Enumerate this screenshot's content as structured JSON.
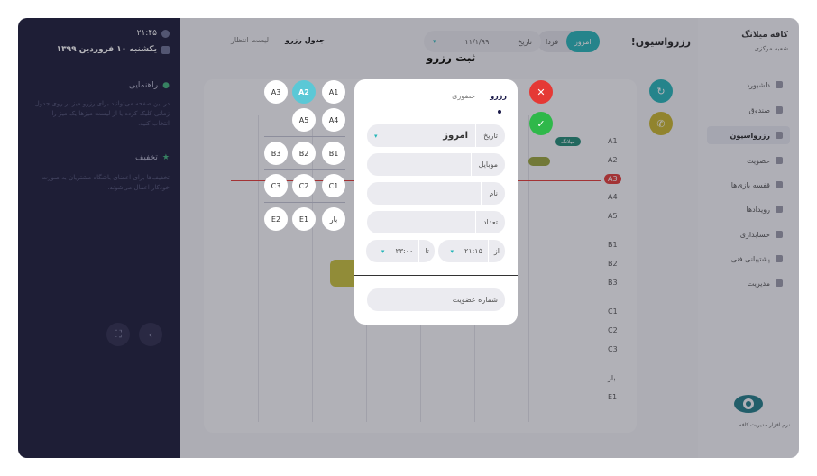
{
  "clock": {
    "time": "۲۱:۴۵",
    "date": "یکشنبه ۱۰ فروردین ۱۳۹۹"
  },
  "guide": {
    "title": "راهنمایی",
    "text": "در این صفحه می‌توانید برای رزرو میز بر روی جدول زمانی کلیک کرده یا از لیست میزها یک میز را انتخاب کنید."
  },
  "discount": {
    "title": "تخفیف",
    "text": "تخفیف‌ها برای اعضای باشگاه مشتریان به صورت خودکار اعمال می‌شوند."
  },
  "sidebar": {
    "brand": "کافه میلانگ",
    "branch": "شعبه مرکزی",
    "items": [
      {
        "label": "داشبورد"
      },
      {
        "label": "صندوق"
      },
      {
        "label": "رزرواسیون"
      },
      {
        "label": "عضویت"
      },
      {
        "label": "قفسه بازی‌ها"
      },
      {
        "label": "رویدادها"
      },
      {
        "label": "حسابداری"
      },
      {
        "label": "پشتیبانی فنی"
      },
      {
        "label": "مدیریت"
      }
    ],
    "footer": "نرم افزار مدیریت کافه"
  },
  "header": {
    "title": "رزرواسیون!",
    "day_today": "امروز",
    "day_tomorrow": "فردا",
    "date_label": "تاریخ",
    "date_value": "۱۱/۱/۹۹",
    "tab_schedule": "جدول رزرو",
    "tab_waitlist": "لیست انتظار"
  },
  "grid": {
    "rows": [
      "A1",
      "A2",
      "A3",
      "A4",
      "A5",
      "B1",
      "B2",
      "B3",
      "C1",
      "C2",
      "C3",
      "بار",
      "E1"
    ],
    "booking_label": "میلانگ"
  },
  "modal": {
    "title": "ثبت رزرو",
    "tab_reserve": "رزرو",
    "tab_walkin": "حضوری",
    "date_label": "تاریخ",
    "date_value": "امروز",
    "mobile_label": "موبایل",
    "name_label": "نام",
    "count_label": "تعداد",
    "from_label": "از",
    "from_value": "۲۱:۱۵",
    "to_label": "تا",
    "to_value": "۲۳:۰۰",
    "membership_label": "شماره عضویت"
  },
  "tables": {
    "row1": [
      "A1",
      "A2",
      "A3"
    ],
    "row2": [
      "A4",
      "A5"
    ],
    "row3": [
      "B1",
      "B2",
      "B3"
    ],
    "row4": [
      "C1",
      "C2",
      "C3"
    ],
    "row5": [
      "بار",
      "E1",
      "E2"
    ],
    "selected": "A2"
  },
  "colors": {
    "accent": "#24b6b8",
    "cancel": "#e53935",
    "confirm": "#2fb84a",
    "selected_table": "#5bc8d6",
    "dark_panel": "#1a1936"
  }
}
